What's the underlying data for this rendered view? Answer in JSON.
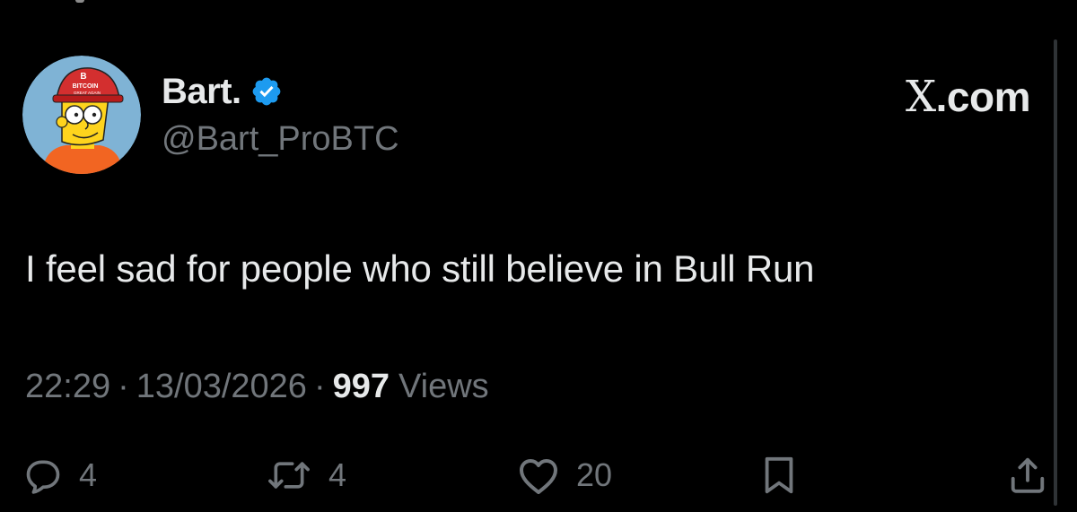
{
  "author": {
    "display_name": "Bart.",
    "handle": "@Bart_ProBTC",
    "verified": true,
    "avatar_cap_text": "BITCOIN",
    "avatar_cap_subtext": "GREAT AGAIN"
  },
  "brand": {
    "x_letter": "X",
    "suffix": ".com"
  },
  "tweet": {
    "text": "I feel sad for people who still believe in Bull Run"
  },
  "meta": {
    "time": "22:29",
    "separator": "·",
    "date": "13/03/2026",
    "views_count": "997",
    "views_label": "Views"
  },
  "actions": {
    "replies": "4",
    "reposts": "4",
    "likes": "20"
  },
  "icons": {
    "reply": "reply-icon",
    "repost": "repost-icon",
    "like": "heart-icon",
    "bookmark": "bookmark-icon",
    "share": "share-icon",
    "verified": "verified-badge-icon"
  },
  "colors": {
    "background": "#000000",
    "text_primary": "#e7e9ea",
    "text_secondary": "#71767b",
    "verified_blue": "#1d9bf0",
    "avatar_bg": "#7fb3d5",
    "cap_red": "#d32f2f",
    "bart_yellow": "#fed41d",
    "shirt_orange": "#f26522"
  }
}
